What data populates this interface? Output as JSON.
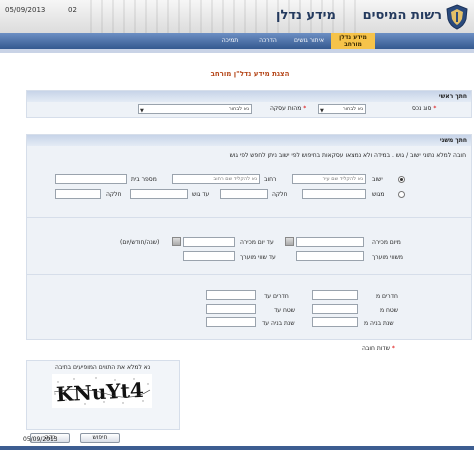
{
  "header": {
    "date": "05/09/2013",
    "number": "02",
    "authority": "רשות המיסים",
    "system": "מידע נדלן"
  },
  "nav": {
    "items": [
      {
        "label": "מידע נדלן",
        "label2": "מורחב",
        "active": true
      },
      {
        "label": "איתור גושים",
        "active": false
      },
      {
        "label": "הדרכה",
        "active": false
      },
      {
        "label": "תמיכה",
        "active": false
      }
    ]
  },
  "page_title": "הצגת מידע נדל\"ן מורחב",
  "main_field": {
    "title": "חתך ראשי",
    "asset_type_label": "סוג נכס",
    "asset_type_value": "נא לבחור",
    "deal_type_label": "מהות עסקה",
    "deal_type_value": "נא לבחור"
  },
  "secondary": {
    "title": "חתך משני",
    "hint": "חובה למלא נתוני ישוב / גוש . במידה ולא נמצאו עסקאות בחיפוש לפי ישוב ניתן לחפש לפי גוש",
    "city_label": "ישוב",
    "city_placeholder": "נא להקליד שם עיר",
    "street_label": "רחוב",
    "street_placeholder": "נא להקליד שם רחוב",
    "house_label": "מספר בית",
    "block_label": "מגוש",
    "parcel_label": "חלקה",
    "to_block_label": "עד גוש",
    "to_parcel_label": "חלקה",
    "sale_from_label": "מיום מכירה",
    "sale_to_label": "עד יום מכירה",
    "date_format": "(שנה/חודש/יום)",
    "duration_label": "משווי מוערך",
    "duration_to_label": "עד שווי מוערך",
    "rooms_from_label": "חדרים מ",
    "rooms_to_label": "חדרים עד",
    "area_from_label": "שטח מ",
    "area_to_label": "שטח עד",
    "year_from_label": "שנת בניה מ",
    "year_to_label": "שנת בניה עד"
  },
  "required_note": "שדות חובה",
  "captcha": {
    "instruction": "נא למלא את התווים המופיעים בתיבה",
    "text": "KNuYt4"
  },
  "buttons": {
    "search": "חיפוש",
    "clear": "נקה"
  },
  "footer_date": "05/09/2013"
}
